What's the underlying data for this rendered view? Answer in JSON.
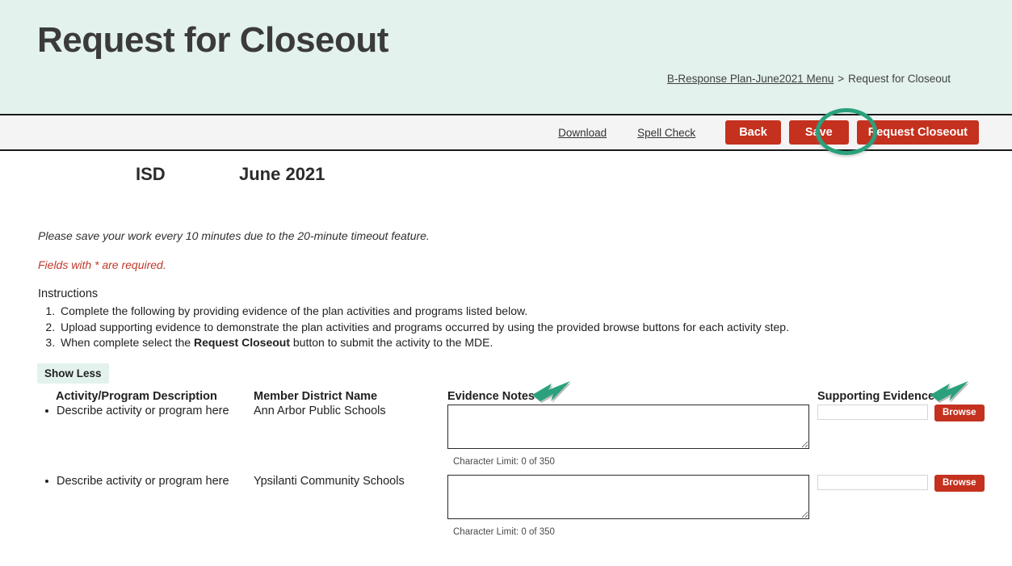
{
  "header": {
    "title": "Request for Closeout",
    "breadcrumb": {
      "parent": "B-Response Plan-June2021 Menu",
      "separator": ">",
      "current": "Request for Closeout"
    }
  },
  "toolbar": {
    "download_label": "Download",
    "spell_check_label": "Spell Check",
    "back_label": "Back",
    "save_label": "Save",
    "request_closeout_label": "Request Closeout"
  },
  "org": {
    "isd_label": "ISD",
    "period_label": "June 2021"
  },
  "notices": {
    "save_reminder": "Please save your work every 10 minutes due to the 20-minute timeout feature.",
    "required_fields": "Fields with * are required."
  },
  "instructions": {
    "heading": "Instructions",
    "items": [
      "Complete the following by providing evidence of the plan activities and programs listed below.",
      "Upload supporting evidence to demonstrate the plan activities and programs occurred by using the provided browse buttons for each activity step."
    ],
    "item3_prefix": "When complete select the ",
    "item3_bold": "Request Closeout",
    "item3_suffix": " button to submit the activity to the MDE."
  },
  "controls": {
    "show_less_label": "Show Less"
  },
  "table": {
    "headers": {
      "activity": "Activity/Program Description",
      "district": "Member District Name",
      "evidence_notes": "Evidence Notes",
      "supporting_evidence": "Supporting Evidence",
      "required_marker": "*"
    },
    "browse_label": "Browse",
    "rows": [
      {
        "activity": "Describe activity or program here",
        "district": "Ann Arbor Public Schools",
        "notes_value": "",
        "char_limit": "Character Limit: 0 of 350",
        "file_value": ""
      },
      {
        "activity": "Describe activity or program here",
        "district": "Ypsilanti Community Schools",
        "notes_value": "",
        "char_limit": "Character Limit: 0 of 350",
        "file_value": ""
      }
    ]
  },
  "annotations": {
    "ellipse_target": "save-button",
    "arrow_1_target": "evidence-notes-header",
    "arrow_2_target": "supporting-evidence-header",
    "accent_green": "#2aa17c",
    "accent_red": "#c4311f",
    "header_bg": "#e3f2ed"
  }
}
